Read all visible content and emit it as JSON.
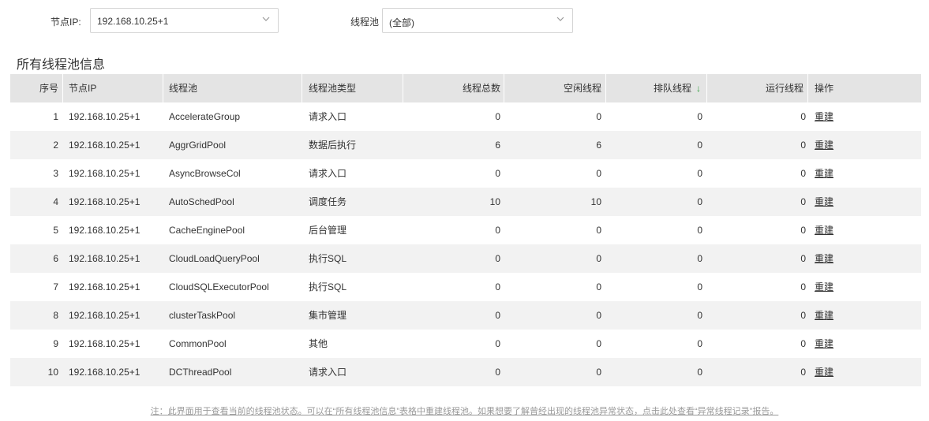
{
  "filters": {
    "node_label": "节点IP:",
    "node_value": "192.168.10.25+1",
    "pool_label": "线程池",
    "pool_value": "(全部)"
  },
  "section_title": "所有线程池信息",
  "table": {
    "columns": [
      "序号",
      "节点IP",
      "线程池",
      "线程池类型",
      "线程总数",
      "空闲线程",
      "排队线程",
      "运行线程",
      "操作"
    ],
    "sort_column": "排队线程",
    "sort_indicator": "↓",
    "rows": [
      {
        "index": "1",
        "ip": "192.168.10.25+1",
        "pool": "AccelerateGroup",
        "type": "请求入口",
        "total": "0",
        "idle": "0",
        "queued": "0",
        "running": "0",
        "action": "重建"
      },
      {
        "index": "2",
        "ip": "192.168.10.25+1",
        "pool": "AggrGridPool",
        "type": "数据后执行",
        "total": "6",
        "idle": "6",
        "queued": "0",
        "running": "0",
        "action": "重建"
      },
      {
        "index": "3",
        "ip": "192.168.10.25+1",
        "pool": "AsyncBrowseCol",
        "type": "请求入口",
        "total": "0",
        "idle": "0",
        "queued": "0",
        "running": "0",
        "action": "重建"
      },
      {
        "index": "4",
        "ip": "192.168.10.25+1",
        "pool": "AutoSchedPool",
        "type": "调度任务",
        "total": "10",
        "idle": "10",
        "queued": "0",
        "running": "0",
        "action": "重建"
      },
      {
        "index": "5",
        "ip": "192.168.10.25+1",
        "pool": "CacheEnginePool",
        "type": "后台管理",
        "total": "0",
        "idle": "0",
        "queued": "0",
        "running": "0",
        "action": "重建"
      },
      {
        "index": "6",
        "ip": "192.168.10.25+1",
        "pool": "CloudLoadQueryPool",
        "type": "执行SQL",
        "total": "0",
        "idle": "0",
        "queued": "0",
        "running": "0",
        "action": "重建"
      },
      {
        "index": "7",
        "ip": "192.168.10.25+1",
        "pool": "CloudSQLExecutorPool",
        "type": "执行SQL",
        "total": "0",
        "idle": "0",
        "queued": "0",
        "running": "0",
        "action": "重建"
      },
      {
        "index": "8",
        "ip": "192.168.10.25+1",
        "pool": "clusterTaskPool",
        "type": "集市管理",
        "total": "0",
        "idle": "0",
        "queued": "0",
        "running": "0",
        "action": "重建"
      },
      {
        "index": "9",
        "ip": "192.168.10.25+1",
        "pool": "CommonPool",
        "type": "其他",
        "total": "0",
        "idle": "0",
        "queued": "0",
        "running": "0",
        "action": "重建"
      },
      {
        "index": "10",
        "ip": "192.168.10.25+1",
        "pool": "DCThreadPool",
        "type": "请求入口",
        "total": "0",
        "idle": "0",
        "queued": "0",
        "running": "0",
        "action": "重建"
      }
    ]
  },
  "footer_note": "注：此界面用于查看当前的线程池状态。可以在“所有线程池信息”表格中重建线程池。如果想要了解曾经出现的线程池异常状态，点击此处查看“异常线程记录”报告。",
  "colors": {
    "header_bg": "#e4e4e4",
    "alt_row_bg": "#f2f2f2",
    "sort_arrow": "#2e9e3a"
  }
}
